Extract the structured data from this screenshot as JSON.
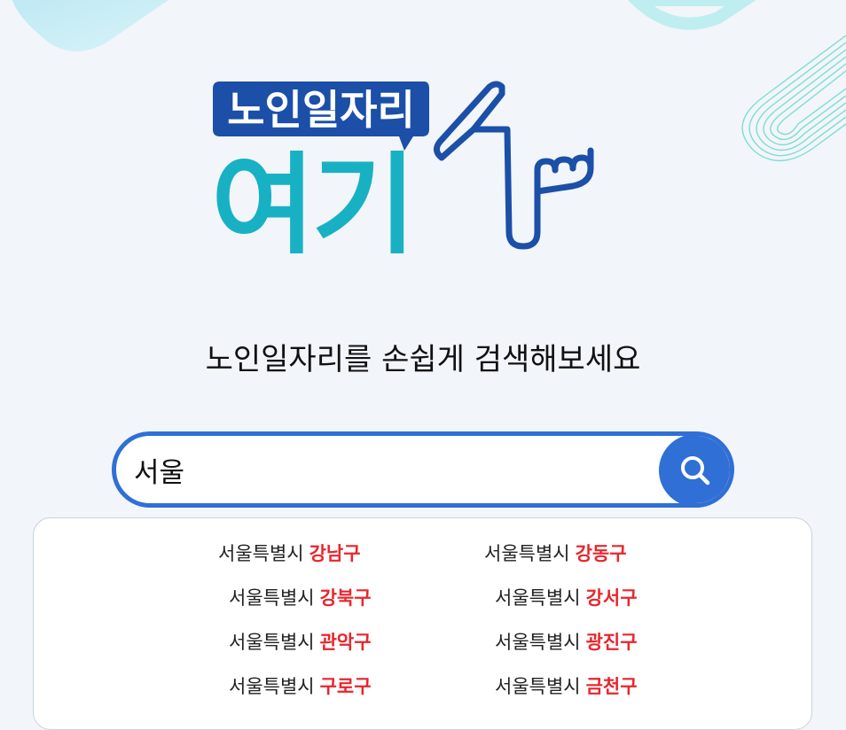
{
  "logo": {
    "badge_text": "노인일자리",
    "main_text": "여기"
  },
  "tagline": "노인일자리를 손쉽게 검색해보세요",
  "search": {
    "value": "서울",
    "button_icon": "search-icon"
  },
  "suggestions": [
    {
      "city": "서울특별시",
      "district": "강남구"
    },
    {
      "city": "서울특별시",
      "district": "강동구"
    },
    {
      "city": "서울특별시",
      "district": "강북구"
    },
    {
      "city": "서울특별시",
      "district": "강서구"
    },
    {
      "city": "서울특별시",
      "district": "관악구"
    },
    {
      "city": "서울특별시",
      "district": "광진구"
    },
    {
      "city": "서울특별시",
      "district": "구로구"
    },
    {
      "city": "서울특별시",
      "district": "금천구"
    }
  ],
  "colors": {
    "primary": "#2f6fd6",
    "logo_navy": "#1b4fa8",
    "logo_teal": "#18b1c4",
    "district_red": "#e8262d",
    "background": "#f2f5f9"
  }
}
